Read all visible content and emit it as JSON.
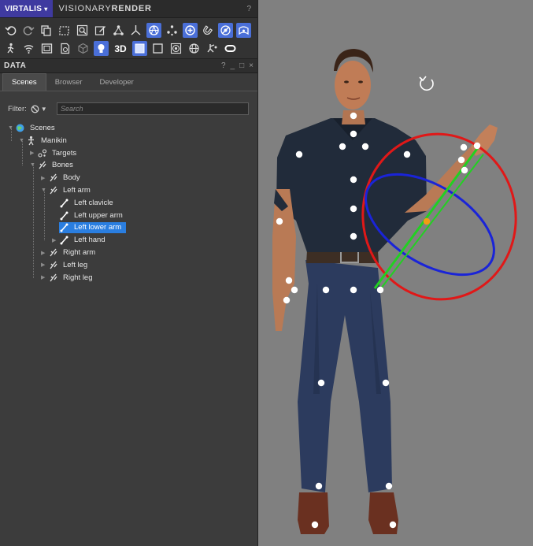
{
  "app": {
    "brand": "VIRTALIS",
    "brand_caret": "▾",
    "name_part1": "VISIONARY",
    "name_part2": "RENDER",
    "help": "?"
  },
  "toolbar": {
    "row1": [
      "undo-icon",
      "redo-icon",
      "copy-icon",
      "select-rect-icon",
      "zoom-icon",
      "edit-icon",
      "hierarchy-icon",
      "axes-icon",
      "mesh-icon",
      "points-icon",
      "add-node-icon",
      "magnet-icon",
      "transform-icon",
      "surface-icon"
    ],
    "row1_active": [
      "mesh-icon",
      "add-node-icon",
      "transform-icon",
      "surface-icon"
    ],
    "row2": [
      "walk-icon",
      "wifi-icon",
      "layout-icon",
      "document-icon",
      "cube-icon",
      "light-icon",
      "3d-label",
      "view-square-icon",
      "box-icon",
      "sphere-icon",
      "globe-icon",
      "gizmo-icon",
      "headset-icon"
    ],
    "row2_active": [
      "light-icon",
      "view-square-icon"
    ],
    "label_3d": "3D"
  },
  "data_panel": {
    "title": "DATA",
    "controls": [
      "?",
      "_",
      "□",
      "×"
    ],
    "tabs": [
      "Scenes",
      "Browser",
      "Developer"
    ],
    "active_tab": "Scenes",
    "filter_label": "Filter:",
    "search_placeholder": "Search"
  },
  "tree": [
    {
      "label": "Scenes",
      "icon": "globe-icon",
      "expanded": true
    },
    {
      "label": "Manikin",
      "icon": "figure-icon",
      "expanded": true
    },
    {
      "label": "Targets",
      "icon": "targets-icon",
      "expanded": false
    },
    {
      "label": "Bones",
      "icon": "bone-chain-icon",
      "expanded": true
    },
    {
      "label": "Body",
      "icon": "bone-chain-icon",
      "expanded": false
    },
    {
      "label": "Left arm",
      "icon": "bone-chain-icon",
      "expanded": true
    },
    {
      "label": "Left clavicle",
      "icon": "bone-icon"
    },
    {
      "label": "Left upper arm",
      "icon": "bone-icon"
    },
    {
      "label": "Left lower arm",
      "icon": "bone-icon",
      "selected": true
    },
    {
      "label": "Left hand",
      "icon": "bone-icon",
      "expanded": false
    },
    {
      "label": "Right arm",
      "icon": "bone-chain-icon",
      "expanded": false
    },
    {
      "label": "Left leg",
      "icon": "bone-chain-icon",
      "expanded": false
    },
    {
      "label": "Right leg",
      "icon": "bone-chain-icon",
      "expanded": false
    }
  ],
  "colors": {
    "accent": "#4a6fd8",
    "selection": "#2a7ee0",
    "viewport_bg": "#808080",
    "gizmo_red": "#e01818",
    "gizmo_blue": "#1a24d8",
    "gizmo_green": "#22d022",
    "joint_active": "#f39c12"
  },
  "viewport": {
    "rotate_icon": "rotate-icon",
    "model": "Manikin"
  }
}
